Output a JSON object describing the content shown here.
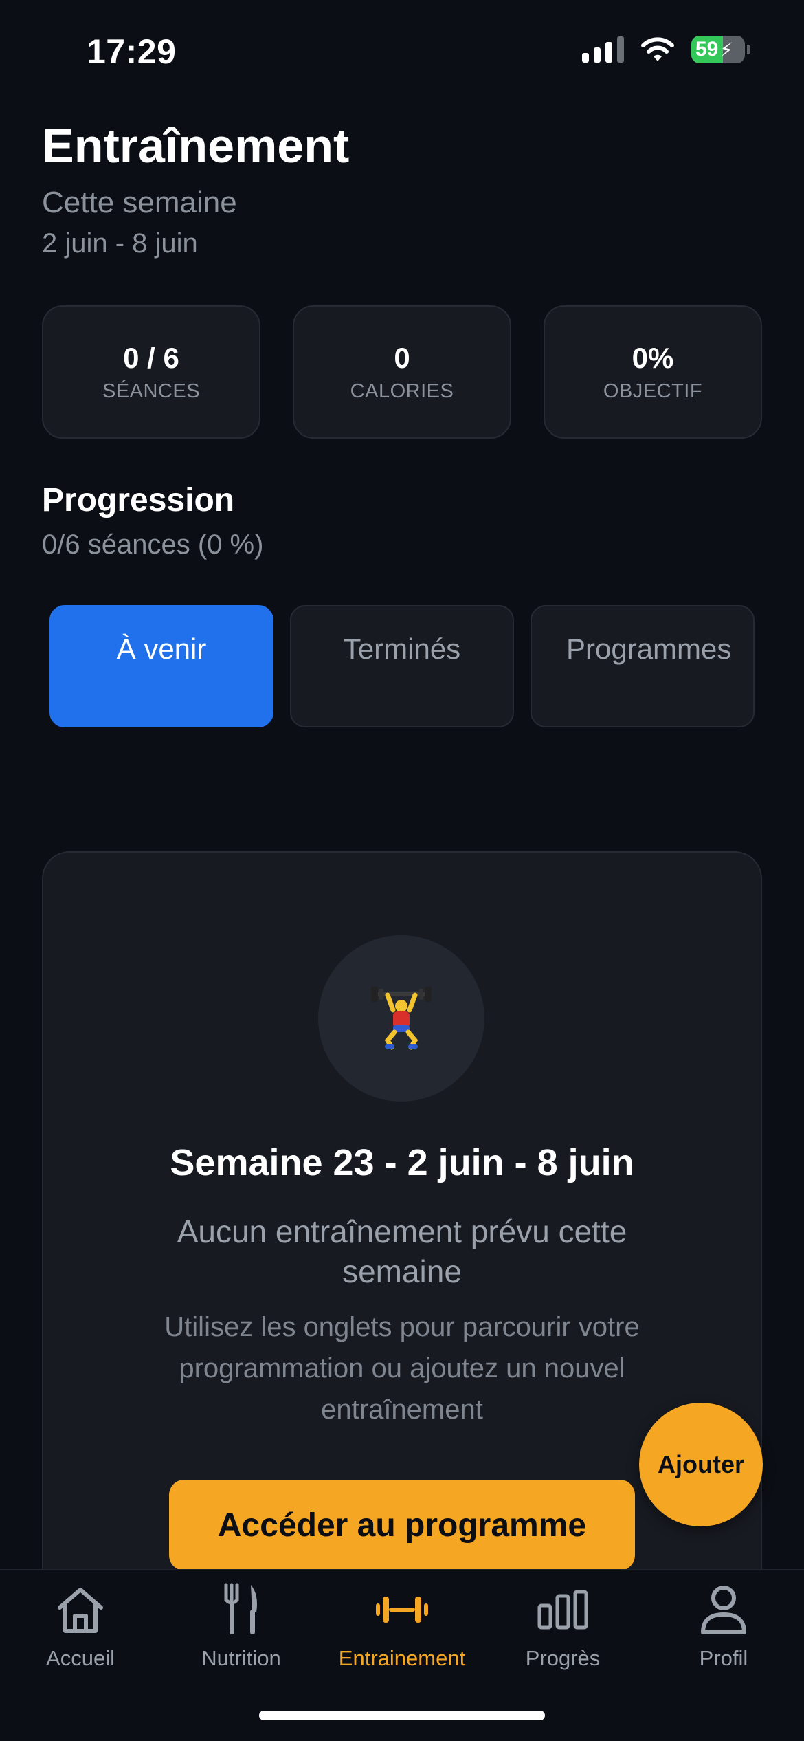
{
  "status_bar": {
    "time": "17:29",
    "battery": "59"
  },
  "header": {
    "title": "Entraînement",
    "subtitle": "Cette semaine",
    "date_range": "2 juin - 8 juin"
  },
  "stats": [
    {
      "value": "0 / 6",
      "label": "SÉANCES"
    },
    {
      "value": "0",
      "label": "CALORIES"
    },
    {
      "value": "0%",
      "label": "OBJECTIF"
    }
  ],
  "progress": {
    "title": "Progression",
    "subtitle": "0/6 séances (0 %)"
  },
  "tabs": [
    {
      "label": "À venir",
      "active": true
    },
    {
      "label": "Terminés",
      "active": false
    },
    {
      "label": "Programmes",
      "active": false
    }
  ],
  "empty_state": {
    "emoji": "🏋️",
    "week_title": "Semaine 23 - 2 juin - 8 juin",
    "message": "Aucun entraînement prévu cette semaine",
    "hint": "Utilisez les onglets pour parcourir votre programmation ou ajoutez un nouvel entraînement",
    "primary_button": "Accéder au programme"
  },
  "fab": {
    "label": "Ajouter"
  },
  "bottom_nav": [
    {
      "label": "Accueil",
      "icon": "home-icon",
      "active": false
    },
    {
      "label": "Nutrition",
      "icon": "fork-knife-icon",
      "active": false
    },
    {
      "label": "Entrainement",
      "icon": "dumbbell-icon",
      "active": true
    },
    {
      "label": "Progrès",
      "icon": "bar-chart-icon",
      "active": false
    },
    {
      "label": "Profil",
      "icon": "person-icon",
      "active": false
    }
  ],
  "colors": {
    "accent": "#f5a623",
    "tab_active": "#2271ec",
    "background": "#0b0e14",
    "card": "#171a21"
  }
}
